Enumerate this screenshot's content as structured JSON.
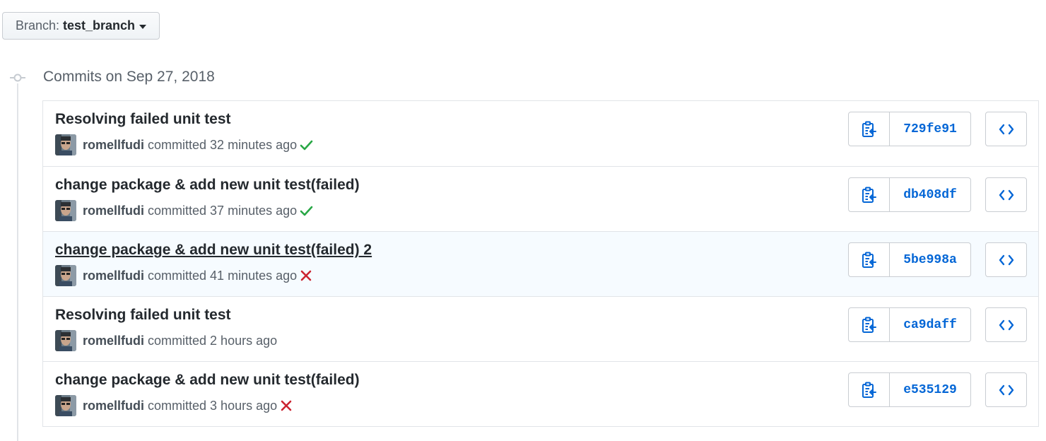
{
  "branch": {
    "prefix": "Branch:",
    "name": "test_branch"
  },
  "group": {
    "title": "Commits on Sep 27, 2018"
  },
  "colors": {
    "link": "#0366d6",
    "success": "#28a745",
    "failure": "#cb2431"
  },
  "commits": [
    {
      "title": "Resolving failed unit test",
      "author": "romellfudi",
      "committed": "committed",
      "time": "32 minutes ago",
      "status": "success",
      "sha": "729fe91"
    },
    {
      "title": "change package & add new unit test(failed)",
      "author": "romellfudi",
      "committed": "committed",
      "time": "37 minutes ago",
      "status": "success",
      "sha": "db408df"
    },
    {
      "title": "change package & add new unit test(failed) 2",
      "author": "romellfudi",
      "committed": "committed",
      "time": "41 minutes ago",
      "status": "failure",
      "sha": "5be998a"
    },
    {
      "title": "Resolving failed unit test",
      "author": "romellfudi",
      "committed": "committed",
      "time": "2 hours ago",
      "status": "none",
      "sha": "ca9daff"
    },
    {
      "title": "change package & add new unit test(failed)",
      "author": "romellfudi",
      "committed": "committed",
      "time": "3 hours ago",
      "status": "failure",
      "sha": "e535129"
    }
  ]
}
